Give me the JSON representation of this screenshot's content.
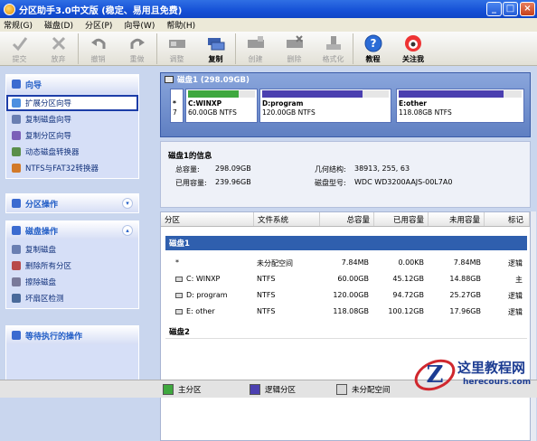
{
  "title": "分区助手3.0中文版 (稳定、易用且免费)",
  "window_controls": [
    "_",
    "□",
    "×"
  ],
  "menu": [
    "常规(G)",
    "磁盘(D)",
    "分区(P)",
    "向导(W)",
    "帮助(H)"
  ],
  "toolbar": {
    "buttons": [
      {
        "label": "提交",
        "icon": "check-icon",
        "enabled": false
      },
      {
        "label": "放弃",
        "icon": "x-icon",
        "enabled": false
      },
      {
        "label": "撤销",
        "icon": "undo-icon",
        "enabled": false
      },
      {
        "label": "重做",
        "icon": "redo-icon",
        "enabled": false
      },
      {
        "label": "调整",
        "icon": "resize-icon",
        "enabled": false
      },
      {
        "label": "复制",
        "icon": "copy-disk-icon",
        "enabled": true
      },
      {
        "label": "创建",
        "icon": "create-icon",
        "enabled": false
      },
      {
        "label": "删除",
        "icon": "delete-icon",
        "enabled": false
      },
      {
        "label": "格式化",
        "icon": "format-icon",
        "enabled": false
      },
      {
        "label": "教程",
        "icon": "help-icon",
        "enabled": true
      },
      {
        "label": "关注我",
        "icon": "follow-icon",
        "enabled": true
      }
    ]
  },
  "sidebar": {
    "wizard": {
      "title": "向导",
      "items": [
        "扩展分区向导",
        "复制磁盘向导",
        "复制分区向导",
        "动态磁盘转换器",
        "NTFS与FAT32转换器"
      ],
      "selected": "扩展分区向导"
    },
    "partition_ops": {
      "title": "分区操作"
    },
    "disk_ops": {
      "title": "磁盘操作",
      "items": [
        "复制磁盘",
        "删除所有分区",
        "擦除磁盘",
        "坏扇区检测"
      ]
    },
    "pending": {
      "title": "等待执行的操作"
    }
  },
  "diskmap": {
    "header": "磁盘1 (298.09GB)",
    "segments": [
      {
        "name": "*",
        "size": "7",
        "color": "#4a4a4a",
        "fill_percent": 0
      },
      {
        "name": "C:WINXP",
        "size": "60.00GB NTFS",
        "color": "#3fa83f",
        "fill_percent": 75
      },
      {
        "name": "D:program",
        "size": "120.00GB NTFS",
        "color": "#4b3fb0",
        "fill_percent": 79
      },
      {
        "name": "E:other",
        "size": "118.08GB NTFS",
        "color": "#4b3fb0",
        "fill_percent": 85
      }
    ]
  },
  "disk_info": {
    "title": "磁盘1的信息",
    "total_label": "总容量:",
    "total_value": "298.09GB",
    "used_label": "已用容量:",
    "used_value": "239.96GB",
    "geometry_label": "几何结构:",
    "geometry_value": "38913, 255, 63",
    "model_label": "磁盘型号:",
    "model_value": "WDC WD3200AAJS-00L7A0"
  },
  "table": {
    "headers": [
      "分区",
      "文件系统",
      "总容量",
      "已用容量",
      "未用容量",
      "标记"
    ],
    "groups": [
      {
        "name": "磁盘1",
        "rows": [
          [
            "*",
            "未分配空间",
            "7.84MB",
            "0.00KB",
            "7.84MB",
            "逻辑"
          ],
          [
            "C: WINXP",
            "NTFS",
            "60.00GB",
            "45.12GB",
            "14.88GB",
            "主"
          ],
          [
            "D: program",
            "NTFS",
            "120.00GB",
            "94.72GB",
            "25.27GB",
            "逻辑"
          ],
          [
            "E: other",
            "NTFS",
            "118.08GB",
            "100.12GB",
            "17.96GB",
            "逻辑"
          ]
        ]
      },
      {
        "name": "磁盘2",
        "rows": []
      }
    ]
  },
  "legend": [
    {
      "label": "主分区",
      "color": "#3fa83f"
    },
    {
      "label": "逻辑分区",
      "color": "#4b3fb0"
    },
    {
      "label": "未分配空间",
      "color": "#d8d8d8"
    }
  ],
  "watermark": {
    "text": "这里教程网",
    "url_text": "herecours.com"
  }
}
